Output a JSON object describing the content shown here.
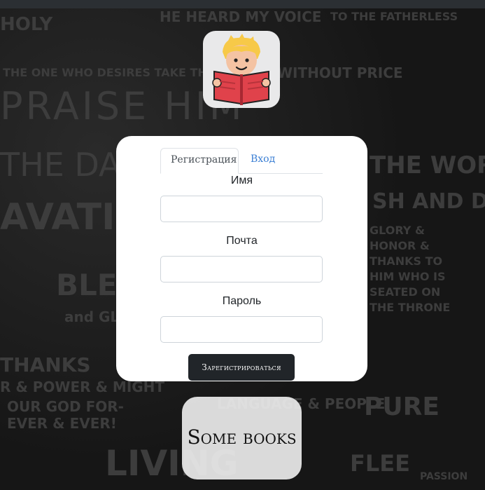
{
  "background_words": [
    "HOLY",
    "HE HEARD MY VOICE",
    "TO THE FATHERLESS",
    "THE ONE WHO DESIRES TAKE THE WATER",
    "WITHOUT PRICE",
    "PRAISE HIM",
    "THE DAY",
    "THE WORD",
    "AVATION",
    "SH AND DW",
    "GLORY & HONOR & THANKS TO HIM WHO IS SEATED ON THE THRONE",
    "BLESS",
    "and GLO",
    "THANKS",
    "R & POWER & MIGHT",
    "OUR GOD FOR-EVER & EVER!",
    "LANGUAGE & PEOPLE",
    "PURE",
    "FLEE",
    "LIVING",
    "PASSION"
  ],
  "logo": {
    "alt": "reading-boy-logo"
  },
  "tabs": [
    {
      "label": "Регистрация",
      "active": true
    },
    {
      "label": "Вход",
      "active": false
    }
  ],
  "form": {
    "name_label": "Имя",
    "name_value": "",
    "email_label": "Почта",
    "email_value": "",
    "password_label": "Пароль",
    "password_value": "",
    "submit_label": "Зарегистрироваться"
  },
  "brand": {
    "label": "Some books"
  },
  "colors": {
    "page_bg": "#161616",
    "card_bg": "#ffffff",
    "button_bg": "#212529",
    "tab_link": "#3b7fd4"
  }
}
